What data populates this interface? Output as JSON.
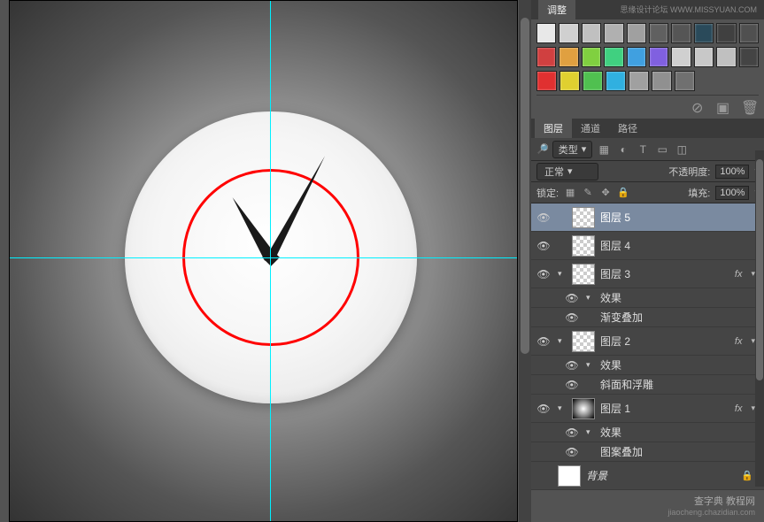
{
  "watermark_top": "思缘设计论坛 WWW.MISSYUAN.COM",
  "watermark_bottom": {
    "main": "查字典 教程网",
    "sub": "jiaocheng.chazidian.com"
  },
  "adjust_tab": "调整",
  "swatches": {
    "row1": [
      "#e8e8e8",
      "#d0d0d0",
      "#c0c0c0",
      "#b0b0b0",
      "#a0a0a0",
      "#606060",
      "#555555",
      "#2a4a5a",
      "#404040",
      "#505050"
    ],
    "row2": [
      "#d04040",
      "#e0a040",
      "#80d040",
      "#40d080",
      "#40a0e0",
      "#8060e0",
      "#d0d0d0",
      "#c8c8c8",
      "#c0c0c0",
      "#444444"
    ],
    "row3": [
      "#e03030",
      "#e0d030",
      "#50c050",
      "#30b0e0",
      "#a0a0a0",
      "#909090",
      "#707070"
    ]
  },
  "layers_panel": {
    "tabs": {
      "layers": "图层",
      "channels": "通道",
      "paths": "路径"
    },
    "kind_label": "类型",
    "blend_mode": "正常",
    "opacity_label": "不透明度:",
    "opacity_value": "100%",
    "lock_label": "锁定:",
    "fill_label": "填充:",
    "fill_value": "100%"
  },
  "layers": [
    {
      "name": "图层 5",
      "fx": false,
      "selected": true,
      "thumb": "checker"
    },
    {
      "name": "图层 4",
      "fx": false,
      "thumb": "checker"
    },
    {
      "name": "图层 3",
      "fx": true,
      "thumb": "checker",
      "effects": [
        "渐变叠加"
      ]
    },
    {
      "name": "图层 2",
      "fx": true,
      "thumb": "checker",
      "effects": [
        "斜面和浮雕"
      ]
    },
    {
      "name": "图层 1",
      "fx": true,
      "thumb": "radial",
      "effects": [
        "图案叠加"
      ]
    }
  ],
  "effects_label": "效果",
  "background_layer": "背景"
}
